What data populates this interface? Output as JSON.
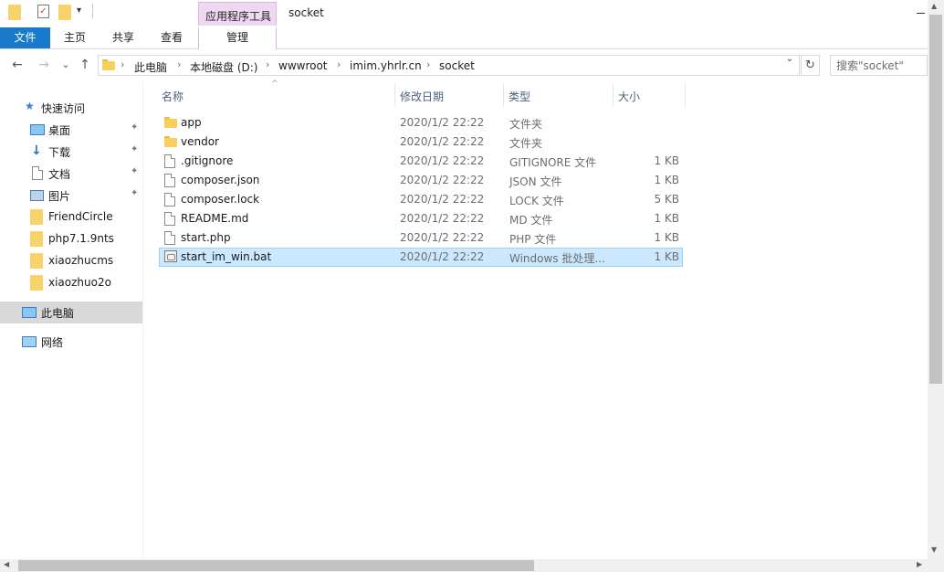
{
  "titlebar": {
    "tool_group_label": "应用程序工具",
    "window_title": "socket",
    "quick_access_dropdown": "▾"
  },
  "ribbon": {
    "tabs": [
      {
        "label": "文件"
      },
      {
        "label": "主页"
      },
      {
        "label": "共享"
      },
      {
        "label": "查看"
      },
      {
        "label": "管理"
      }
    ]
  },
  "navbar": {
    "back": "←",
    "forward": "→",
    "recent": "⌄",
    "up": "↑",
    "breadcrumbs": [
      "此电脑",
      "本地磁盘 (D:)",
      "wwwroot",
      "imim.yhrlr.cn",
      "socket"
    ],
    "separator": "›",
    "dropdown": "⌄",
    "refresh": "↻",
    "search_placeholder": "搜索\"socket\""
  },
  "sidebar": {
    "items": [
      {
        "label": "快速访问",
        "icon": "star-icon"
      },
      {
        "label": "桌面",
        "icon": "desktop-icon",
        "pinned": true
      },
      {
        "label": "下载",
        "icon": "download-icon",
        "pinned": true
      },
      {
        "label": "文档",
        "icon": "documents-icon",
        "pinned": true
      },
      {
        "label": "图片",
        "icon": "pictures-icon",
        "pinned": true
      },
      {
        "label": "FriendCircle",
        "icon": "folder-icon"
      },
      {
        "label": "php7.1.9nts",
        "icon": "folder-icon"
      },
      {
        "label": "xiaozhucms",
        "icon": "folder-icon"
      },
      {
        "label": "xiaozhuo2o",
        "icon": "folder-icon"
      },
      {
        "label": "此电脑",
        "icon": "computer-icon",
        "selected": true
      },
      {
        "label": "网络",
        "icon": "network-icon"
      }
    ],
    "pin_glyph": "📌"
  },
  "filelist": {
    "columns": {
      "name": "名称",
      "modified": "修改日期",
      "type": "类型",
      "size": "大小"
    },
    "sort_caret": "^",
    "rows": [
      {
        "name": "app",
        "modified": "2020/1/2 22:22",
        "type": "文件夹",
        "size": "",
        "icon": "folder-icon"
      },
      {
        "name": "vendor",
        "modified": "2020/1/2 22:22",
        "type": "文件夹",
        "size": "",
        "icon": "folder-icon"
      },
      {
        "name": ".gitignore",
        "modified": "2020/1/2 22:22",
        "type": "GITIGNORE 文件",
        "size": "1 KB",
        "icon": "file-icon"
      },
      {
        "name": "composer.json",
        "modified": "2020/1/2 22:22",
        "type": "JSON 文件",
        "size": "1 KB",
        "icon": "file-icon"
      },
      {
        "name": "composer.lock",
        "modified": "2020/1/2 22:22",
        "type": "LOCK 文件",
        "size": "5 KB",
        "icon": "file-icon"
      },
      {
        "name": "README.md",
        "modified": "2020/1/2 22:22",
        "type": "MD 文件",
        "size": "1 KB",
        "icon": "file-icon"
      },
      {
        "name": "start.php",
        "modified": "2020/1/2 22:22",
        "type": "PHP 文件",
        "size": "1 KB",
        "icon": "file-icon"
      },
      {
        "name": "start_im_win.bat",
        "modified": "2020/1/2 22:22",
        "type": "Windows 批处理...",
        "size": "1 KB",
        "icon": "batch-file-icon",
        "selected": true
      }
    ]
  }
}
